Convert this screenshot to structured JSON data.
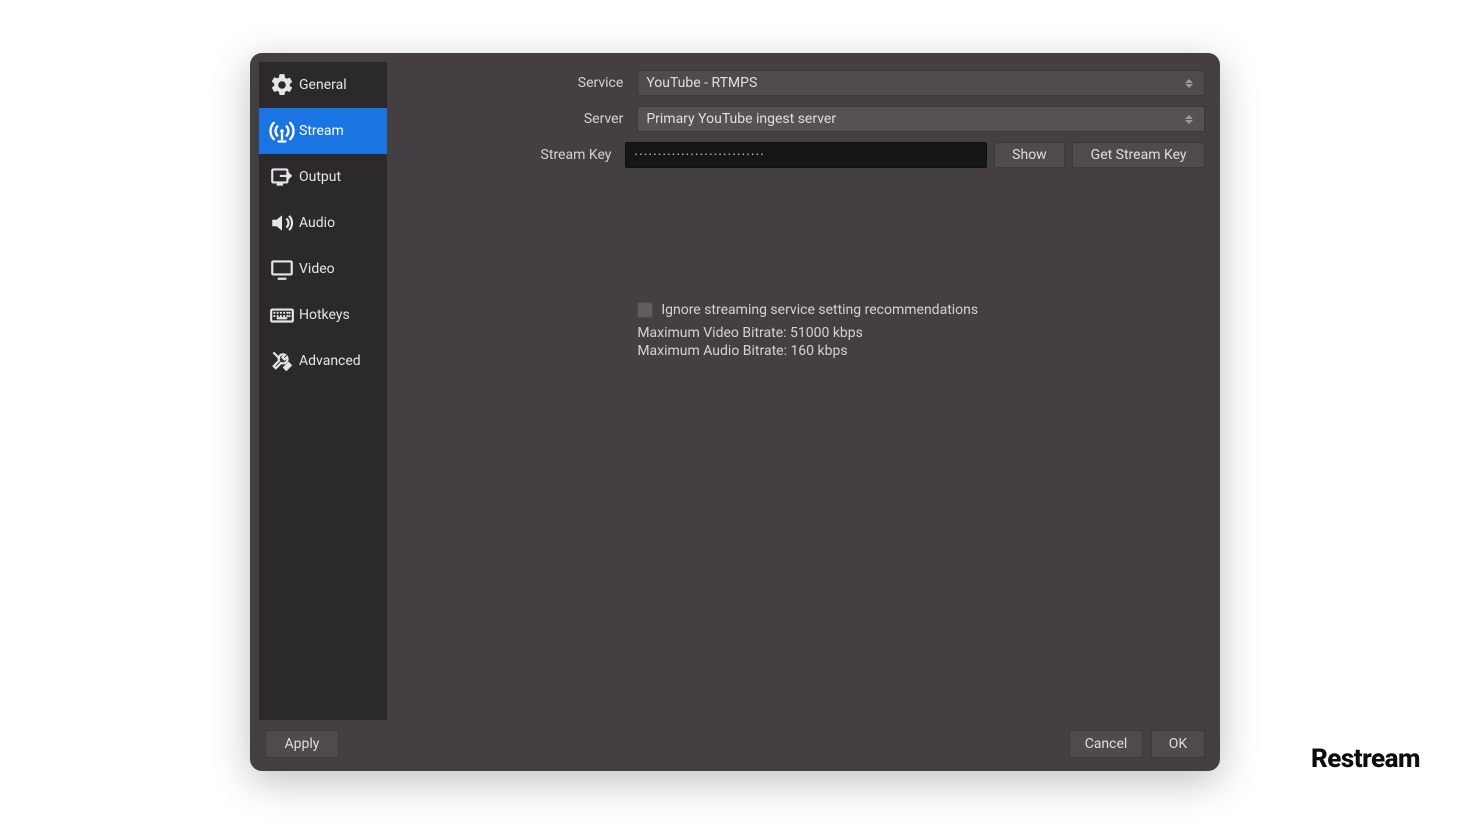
{
  "sidebar": {
    "items": [
      {
        "id": "general",
        "label": "General",
        "icon": "gear-icon"
      },
      {
        "id": "stream",
        "label": "Stream",
        "icon": "antenna-icon"
      },
      {
        "id": "output",
        "label": "Output",
        "icon": "output-icon"
      },
      {
        "id": "audio",
        "label": "Audio",
        "icon": "speaker-icon"
      },
      {
        "id": "video",
        "label": "Video",
        "icon": "monitor-icon"
      },
      {
        "id": "hotkeys",
        "label": "Hotkeys",
        "icon": "keyboard-icon"
      },
      {
        "id": "advanced",
        "label": "Advanced",
        "icon": "tools-icon"
      }
    ],
    "active": "stream"
  },
  "form": {
    "service_label": "Service",
    "service_value": "YouTube - RTMPS",
    "server_label": "Server",
    "server_value": "Primary YouTube ingest server",
    "streamkey_label": "Stream Key",
    "streamkey_value": "····························",
    "show_label": "Show",
    "get_key_label": "Get Stream Key"
  },
  "recommendations": {
    "ignore_label": "Ignore streaming service setting recommendations",
    "ignore_checked": false,
    "video_line": "Maximum Video Bitrate: 51000 kbps",
    "audio_line": "Maximum Audio Bitrate: 160 kbps"
  },
  "footer": {
    "apply": "Apply",
    "cancel": "Cancel",
    "ok": "OK"
  },
  "brand": "Restream"
}
